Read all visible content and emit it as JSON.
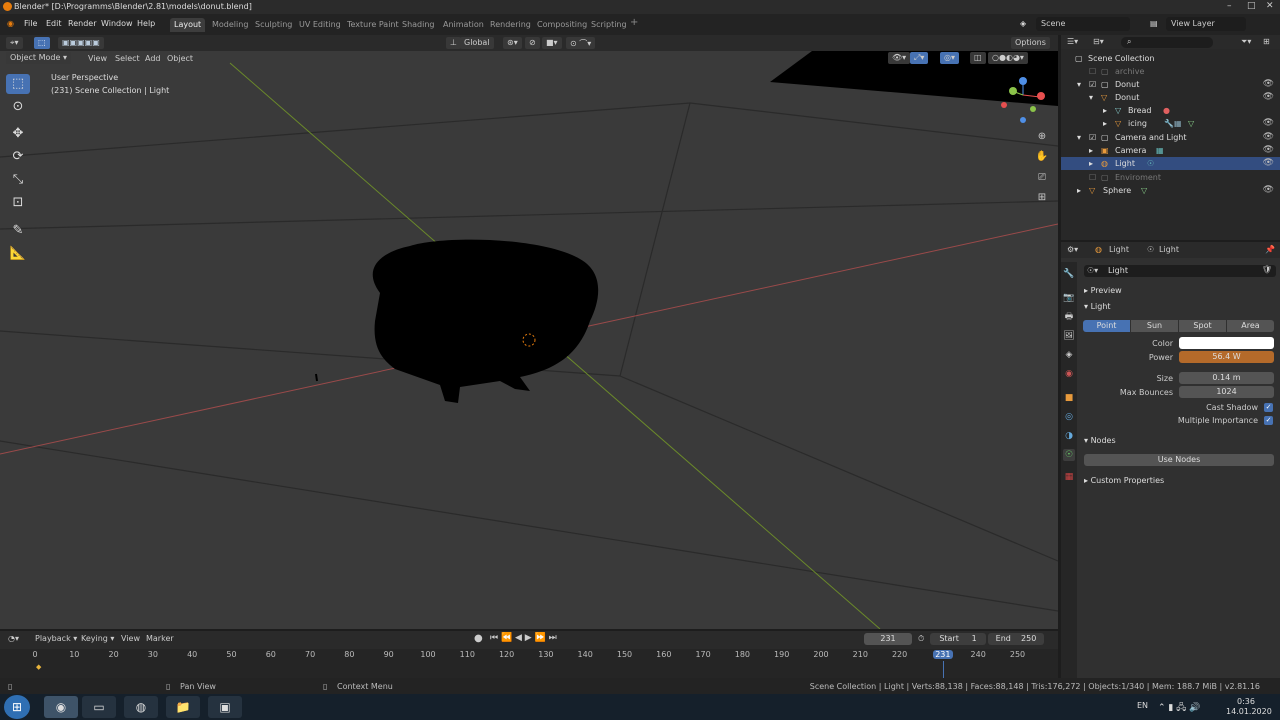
{
  "window": {
    "title": "Blender* [D:\\Programms\\Blender\\2.81\\models\\donut.blend]"
  },
  "menu": {
    "file": "File",
    "edit": "Edit",
    "render": "Render",
    "window": "Window",
    "help": "Help"
  },
  "workspaces": [
    "Layout",
    "Modeling",
    "Sculpting",
    "UV Editing",
    "Texture Paint",
    "Shading",
    "Animation",
    "Rendering",
    "Compositing",
    "Scripting"
  ],
  "scene": {
    "name": "Scene",
    "view_layer": "View Layer"
  },
  "viewport_header": {
    "orientation": "Global",
    "options": "Options",
    "mode": "Object Mode",
    "view": "View",
    "select": "Select",
    "add": "Add",
    "object": "Object"
  },
  "viewport": {
    "perspective": "User Perspective",
    "collection_info": "(231) Scene Collection | Light"
  },
  "outliner": {
    "root": "Scene Collection",
    "rows": [
      {
        "label": "archive"
      },
      {
        "label": "Donut"
      },
      {
        "label": "Donut"
      },
      {
        "label": "Bread"
      },
      {
        "label": "icing"
      },
      {
        "label": "Camera and Light"
      },
      {
        "label": "Camera"
      },
      {
        "label": "Light"
      },
      {
        "label": "Enviroment"
      },
      {
        "label": "Sphere"
      }
    ]
  },
  "properties": {
    "breadcrumb_object": "Light",
    "breadcrumb_data": "Light",
    "datablock": "Light",
    "preview": "Preview",
    "light_section": "Light",
    "light_types": [
      "Point",
      "Sun",
      "Spot",
      "Area"
    ],
    "color_label": "Color",
    "power_label": "Power",
    "power_value": "56.4 W",
    "size_label": "Size",
    "size_value": "0.14 m",
    "bounces_label": "Max Bounces",
    "bounces_value": "1024",
    "cast_shadow": "Cast Shadow",
    "multiple_importance": "Multiple Importance",
    "nodes": "Nodes",
    "use_nodes": "Use Nodes",
    "custom_props": "Custom Properties",
    "colors": {
      "power": "#b46a2a",
      "color_swatch": "#ffffff",
      "accent": "#4772b3"
    }
  },
  "timeline": {
    "playback": "Playback",
    "keying": "Keying",
    "view": "View",
    "marker": "Marker",
    "current_frame": "231",
    "start_label": "Start",
    "start": "1",
    "end_label": "End",
    "end": "250",
    "ticks": [
      "0",
      "10",
      "20",
      "30",
      "40",
      "50",
      "60",
      "70",
      "80",
      "90",
      "100",
      "110",
      "120",
      "130",
      "140",
      "150",
      "160",
      "170",
      "180",
      "190",
      "200",
      "210",
      "220",
      "231",
      "240",
      "250"
    ]
  },
  "status": {
    "pan": "Pan View",
    "context": "Context Menu",
    "info": "Scene Collection | Light | Verts:88,138 | Faces:88,148 | Tris:176,272 | Objects:1/340 | Mem: 188.7 MiB | v2.81.16"
  },
  "taskbar": {
    "lang": "EN",
    "time": "0:36",
    "date": "14.01.2020"
  }
}
